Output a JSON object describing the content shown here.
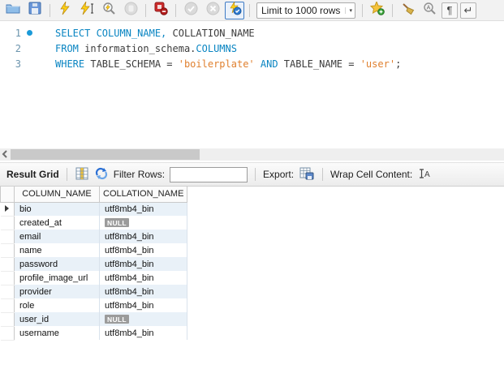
{
  "toolbar": {
    "limit_dropdown": "Limit to 1000 rows",
    "icons": [
      {
        "name": "open-script",
        "enabled": true
      },
      {
        "name": "save-script",
        "enabled": true
      },
      {
        "name": "execute",
        "enabled": true
      },
      {
        "name": "execute-current-statement",
        "enabled": true
      },
      {
        "name": "explain-plan",
        "enabled": true
      },
      {
        "name": "stop-execution",
        "enabled": false
      },
      {
        "name": "toggle-stop-on-error",
        "enabled": true
      },
      {
        "name": "commit",
        "enabled": false
      },
      {
        "name": "rollback",
        "enabled": false
      },
      {
        "name": "toggle-autocommit",
        "enabled": true,
        "active": true
      },
      {
        "name": "add-snippet",
        "enabled": true
      },
      {
        "name": "beautify-script",
        "enabled": true
      },
      {
        "name": "find",
        "enabled": true
      },
      {
        "name": "show-invisibles",
        "enabled": true
      },
      {
        "name": "toggle-wrap",
        "enabled": true
      }
    ],
    "pilcrow_glyph": "¶",
    "wrap_glyph": "↵",
    "dropdown_arrow": "▾",
    "scroll_left_arrow": "‹"
  },
  "editor": {
    "lines": [
      {
        "number": "1",
        "tokens": [
          {
            "c": "kw",
            "t": "SELECT COLUMN_NAME,"
          },
          {
            "c": "pl",
            "t": " COLLATION_NAME"
          }
        ]
      },
      {
        "number": "2",
        "tokens": [
          {
            "c": "kw",
            "t": "FROM"
          },
          {
            "c": "pl",
            "t": " information_schema."
          },
          {
            "c": "kw",
            "t": "COLUMNS"
          }
        ]
      },
      {
        "number": "3",
        "tokens": [
          {
            "c": "kw",
            "t": "WHERE"
          },
          {
            "c": "pl",
            "t": " TABLE_SCHEMA = "
          },
          {
            "c": "str",
            "t": "'boilerplate'"
          },
          {
            "c": "kw",
            "t": " AND"
          },
          {
            "c": "pl",
            "t": " TABLE_NAME = "
          },
          {
            "c": "str",
            "t": "'user'"
          },
          {
            "c": "pl",
            "t": ";"
          }
        ]
      }
    ]
  },
  "result_toolbar": {
    "title": "Result Grid",
    "filter_label": "Filter Rows:",
    "filter_value": "",
    "export_label": "Export:",
    "wrap_label": "Wrap Cell Content:"
  },
  "results": {
    "columns": [
      "COLUMN_NAME",
      "COLLATION_NAME"
    ],
    "null_badge": "NULL",
    "rows": [
      {
        "column_name": "bio",
        "collation": "utf8mb4_bin"
      },
      {
        "column_name": "created_at",
        "collation": null
      },
      {
        "column_name": "email",
        "collation": "utf8mb4_bin"
      },
      {
        "column_name": "name",
        "collation": "utf8mb4_bin"
      },
      {
        "column_name": "password",
        "collation": "utf8mb4_bin"
      },
      {
        "column_name": "profile_image_url",
        "collation": "utf8mb4_bin"
      },
      {
        "column_name": "provider",
        "collation": "utf8mb4_bin"
      },
      {
        "column_name": "role",
        "collation": "utf8mb4_bin"
      },
      {
        "column_name": "user_id",
        "collation": null
      },
      {
        "column_name": "username",
        "collation": "utf8mb4_bin"
      }
    ],
    "colors": {
      "alt_row": "#e9f1f8",
      "null_badge_bg": "#9b9b9b",
      "keyword": "#0a85c2",
      "string": "#e0802f",
      "accent_highlight": "#3f7cc5"
    }
  }
}
